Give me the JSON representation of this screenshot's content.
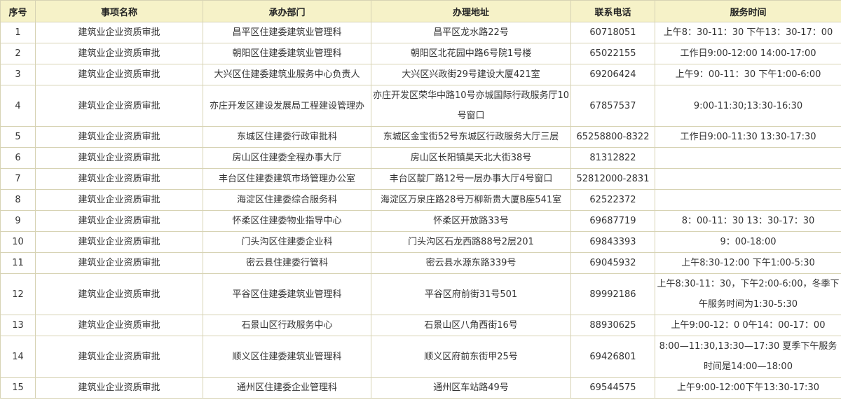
{
  "table": {
    "headers": [
      "序号",
      "事项名称",
      "承办部门",
      "办理地址",
      "联系电话",
      "服务时间"
    ],
    "rows": [
      [
        "1",
        "建筑业企业资质审批",
        "昌平区住建委建筑业管理科",
        "昌平区龙水路22号",
        "60718051",
        "上午8：30-11：30 下午13：30-17：00"
      ],
      [
        "2",
        "建筑业企业资质审批",
        "朝阳区住建委建筑业管理科",
        "朝阳区北花园中路6号院1号楼",
        "65022155",
        "工作日9:00-12:00 14:00-17:00"
      ],
      [
        "3",
        "建筑业企业资质审批",
        "大兴区住建委建筑业服务中心负责人",
        "大兴区兴政街29号建设大厦421室",
        "69206424",
        "上午9：00-11：30 下午1:00-6:00"
      ],
      [
        "4",
        "建筑业企业资质审批",
        "亦庄开发区建设发展局工程建设管理办",
        "亦庄开发区荣华中路10号亦城国际行政服务厅10号窗口",
        "67857537",
        "9:00-11:30;13:30-16:30"
      ],
      [
        "5",
        "建筑业企业资质审批",
        "东城区住建委行政审批科",
        "东城区金宝街52号东城区行政服务大厅三层",
        "65258800-8322",
        "工作日9:00-11:30 13:30-17:30"
      ],
      [
        "6",
        "建筑业企业资质审批",
        "房山区住建委全程办事大厅",
        "房山区长阳镇昊天北大街38号",
        "81312822",
        ""
      ],
      [
        "7",
        "建筑业企业资质审批",
        "丰台区住建委建筑市场管理办公室",
        "丰台区靛厂路12号一层办事大厅4号窗口",
        "52812000-2831",
        ""
      ],
      [
        "8",
        "建筑业企业资质审批",
        "海淀区住建委综合服务科",
        "海淀区万泉庄路28号万柳新贵大厦B座541室",
        "62522372",
        ""
      ],
      [
        "9",
        "建筑业企业资质审批",
        "怀柔区住建委物业指导中心",
        "怀柔区开放路33号",
        "69687719",
        "8：00-11：30 13：30-17：30"
      ],
      [
        "10",
        "建筑业企业资质审批",
        "门头沟区住建委企业科",
        "门头沟区石龙西路88号2层201",
        "69843393",
        "9：00-18:00"
      ],
      [
        "11",
        "建筑业企业资质审批",
        "密云县住建委行管科",
        "密云县水源东路339号",
        "69045932",
        "上午8:30-12:00 下午1:00-5:30"
      ],
      [
        "12",
        "建筑业企业资质审批",
        "平谷区住建委建筑业管理科",
        "平谷区府前街31号501",
        "89992186",
        "上午8:30-11：30，下午2:00-6:00，冬季下午服务时间为1:30-5:30"
      ],
      [
        "13",
        "建筑业企业资质审批",
        "石景山区行政服务中心",
        "石景山区八角西街16号",
        "88930625",
        "上午9:00-12：0 0午14：00-17：00"
      ],
      [
        "14",
        "建筑业企业资质审批",
        "顺义区住建委建筑业管理科",
        "顺义区府前东街甲25号",
        "69426801",
        "8:00—11:30,13:30—17:30 夏季下午服务时间是14:00—18:00"
      ],
      [
        "15",
        "建筑业企业资质审批",
        "通州区住建委企业管理科",
        "通州区车站路49号",
        "69544575",
        "上午9:00-12:00下午13:30-17:30"
      ]
    ]
  },
  "colors": {
    "header_bg": "#f6f2c8",
    "border": "#d7d3b4",
    "text": "#333333"
  }
}
